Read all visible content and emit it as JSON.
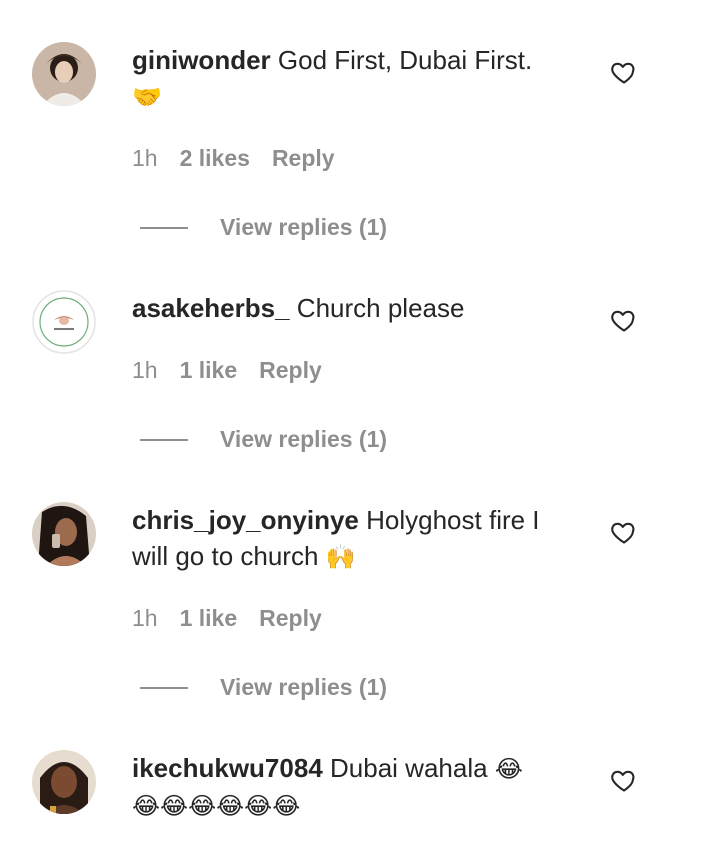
{
  "comments": [
    {
      "username": "giniwonder",
      "text": "God First, Dubai First.",
      "emoji": "🤝",
      "time": "1h",
      "likes": "2 likes",
      "reply": "Reply",
      "view_replies": "View replies (1)"
    },
    {
      "username": "asakeherbs_",
      "text": "Church please",
      "time": "1h",
      "likes": "1 like",
      "reply": "Reply",
      "view_replies": "View replies (1)"
    },
    {
      "username": "chris_joy_onyinye",
      "text": "Holyghost fire I will go to church",
      "emoji": "🙌",
      "time": "1h",
      "likes": "1 like",
      "reply": "Reply",
      "view_replies": "View replies (1)"
    },
    {
      "username": "ikechukwu7084",
      "text": "Dubai wahala",
      "emoji": "😂",
      "emoji_line2": "😂😂😂😂😂😂"
    }
  ],
  "icons": {
    "like": "heart-outline-icon"
  },
  "colors": {
    "text_primary": "#262626",
    "text_secondary": "#8e8e8e"
  }
}
